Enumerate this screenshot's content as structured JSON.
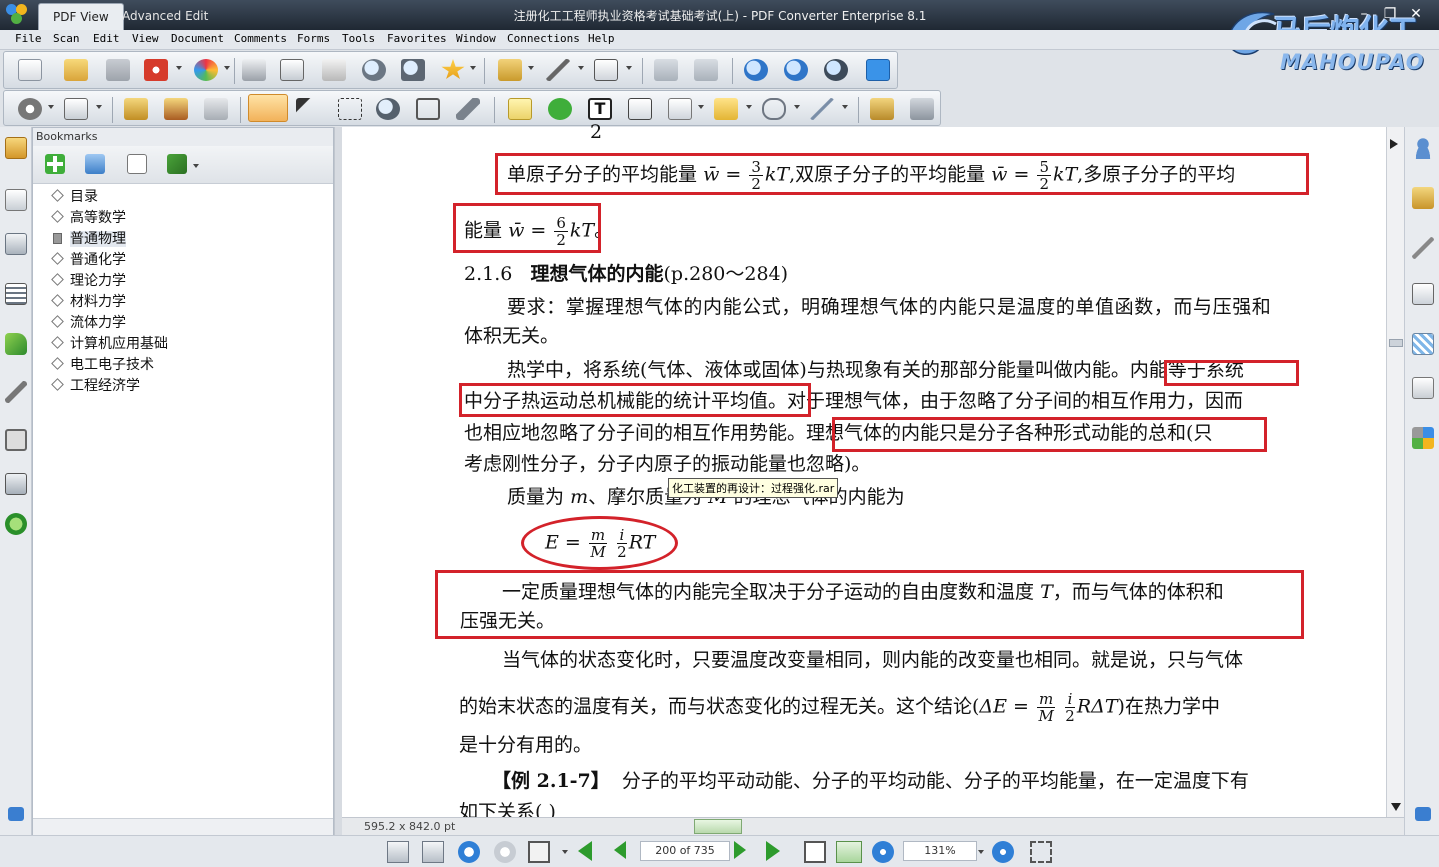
{
  "titlebar": {
    "tabs": [
      "PDF View",
      "Advanced Edit"
    ],
    "window_title": "注册化工工程师执业资格考试基础考试(上) - PDF Converter Enterprise 8.1",
    "brand_main": "马后炮化工",
    "brand_sub": "MAHOUPAO"
  },
  "menu": [
    "File",
    "Scan",
    "Edit",
    "View",
    "Document",
    "Comments",
    "Forms",
    "Tools",
    "Favorites",
    "Window",
    "Connections",
    "Help"
  ],
  "bookmarks": {
    "header": "Bookmarks",
    "items": [
      "目录",
      "高等数学",
      "普通物理",
      "普通化学",
      "理论力学",
      "材料力学",
      "流体力学",
      "计算机应用基础",
      "电工电子技术",
      "工程经济学"
    ],
    "selected": "普通物理"
  },
  "document": {
    "top_fragment": "2",
    "line1_a": "单原子分子的平均能量",
    "line1_b": "双原子分子的平均能量",
    "line1_c": "多原子分子的平均",
    "line2_a": "能量",
    "w_symbol": "w̄",
    "frac_3": "3",
    "frac_5": "5",
    "frac_6": "6",
    "frac_2": "2",
    "kT": "kT",
    "section_number": "2.1.6",
    "section_title": "理想气体的内能",
    "section_pages": "(p.280～284)",
    "req_line1": "要求：掌握理想气体的内能公式，明确理想气体的内能只是温度的单值函数，而与压强和",
    "req_line2": "体积无关。",
    "p1_line1_a": "热学中，将系统(气体、液体或固体)与热现象有关的那部分能量叫做内能。",
    "p1_line1_b": "内能等于系统",
    "p1_line2_a": "中分子热运动总机械能的统计平均值。",
    "p1_line2_b": "对于理想气体，由于忽略了分子间的相互作用力，因而",
    "p1_line3_a": "也相应地忽略了分子间的相互作用势能。",
    "p1_line3_b": "理想气体的内能只是分子各种形式动能的总和",
    "p1_line3_c": "(只",
    "p1_line4": "考虑刚性分子，分子内原子的振动能量也忽略)。",
    "mass_line_a": "质量为",
    "mass_line_b": "、摩尔质量为",
    "mass_line_c": "的理想气体的内能为",
    "var_m": "m",
    "var_M": "M",
    "var_i": "i",
    "var_E": "E",
    "RT": "RT",
    "box2_line1_a": "一定质量理想气体的内能完全取决于分子运动的自由度数和温度",
    "var_T": "T",
    "box2_line1_b": "，而与气体的体积和",
    "box2_line2": "压强无关。",
    "p2_line1": "当气体的状态变化时，只要温度改变量相同，则内能的改变量也相同。就是说，只与气体",
    "p2_line2_a": "的始末状态的温度有关，而与状态变化的过程无关。这个结论(",
    "dE": "ΔE",
    "RdT": "RΔT",
    "p2_line2_b": ")在热力学中",
    "p2_line3": "是十分有用的。",
    "example_label": "【例 2.1-7】",
    "example_text": "分子的平均平动动能、分子的平均动能、分子的平均能量，在一定温度下有",
    "bottom_fragment": "如下关系(        )"
  },
  "tooltip": "化工装置的再设计：过程强化.rar",
  "status": {
    "page_size": "595.2 x 842.0 pt",
    "page_indicator": "200 of 735",
    "zoom": "131%"
  },
  "colors": {
    "annotation_red": "#d3222a",
    "title_bar": "#2b3440"
  }
}
